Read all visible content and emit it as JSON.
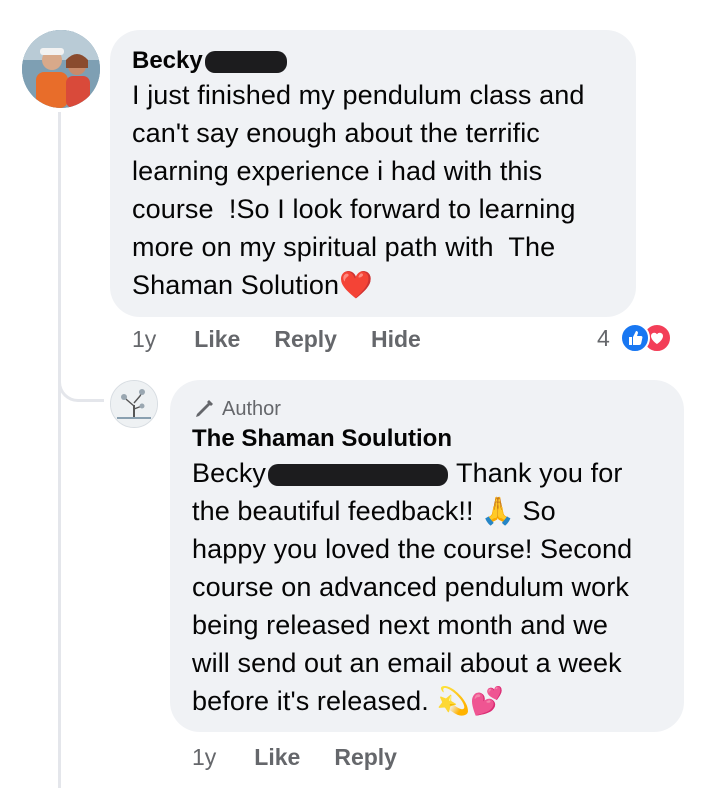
{
  "comment": {
    "author": "Becky",
    "text_lines": [
      "I just finished my pendulum class and",
      "can't say enough about the terrific",
      "learning experience i had with this",
      "course  !So I look forward to learning",
      "more on my spiritual path with  The",
      "Shaman Solution"
    ],
    "heart_emoji": "❤️",
    "time": "1y",
    "like_label": "Like",
    "reply_label": "Reply",
    "hide_label": "Hide",
    "reaction_count": "4"
  },
  "reply": {
    "badge_label": "Author",
    "author": "The Shaman Soulution",
    "mention": "Becky",
    "text_line1_rest": "Thank you for",
    "text_line2": "the beautiful feedback!! ",
    "pray_emoji": "🙏",
    "text_line2_rest": " So",
    "text_lines": [
      "happy you loved the course! Second",
      "course on advanced pendulum work",
      "being released next month and we",
      "will send out an email about a week"
    ],
    "text_last": "before it's released. ",
    "end_emojis": "💫💕",
    "time": "1y",
    "like_label": "Like",
    "reply_label": "Reply"
  },
  "colors": {
    "bubble": "#f0f2f5",
    "muted": "#65676b",
    "like_blue": "#1877f2",
    "love_red": "#f33e58"
  }
}
